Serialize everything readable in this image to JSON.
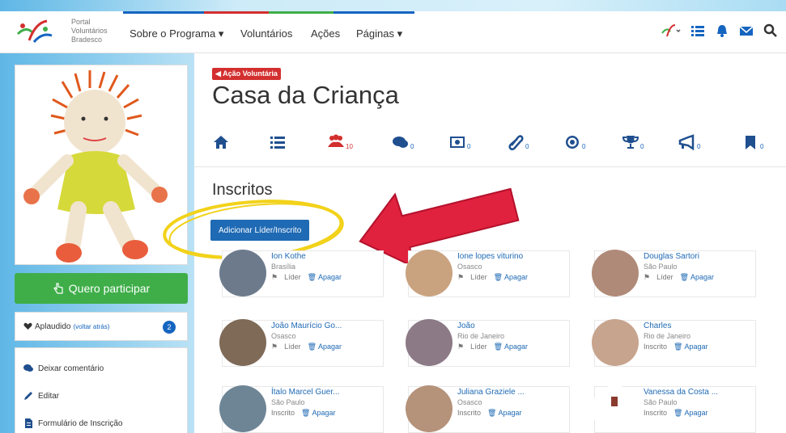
{
  "navbar": {
    "logo_line1": "Portal",
    "logo_line2": "Voluntários",
    "logo_line3": "Bradesco",
    "links": [
      "Sobre o Programa ▾",
      "Voluntários",
      "Ações",
      "Páginas ▾"
    ],
    "icons": [
      "logo-dropdown-icon",
      "list-icon",
      "bell-icon",
      "envelope-icon",
      "search-icon"
    ]
  },
  "left": {
    "participate_label": "Quero participar",
    "applause_label": "Aplaudido",
    "applause_sub": "(voltar atrás)",
    "applause_count": "2",
    "actions": [
      "Deixar comentário",
      "Editar",
      "Formulário de Inscrição"
    ]
  },
  "main": {
    "tag": "Ação Voluntária",
    "title": "Casa da Criança",
    "tabs": [
      {
        "icon": "home-icon",
        "count": ""
      },
      {
        "icon": "list-icon",
        "count": ""
      },
      {
        "icon": "users-icon",
        "count": "10"
      },
      {
        "icon": "comments-icon",
        "count": "0"
      },
      {
        "icon": "photo-icon",
        "count": "0"
      },
      {
        "icon": "paperclip-icon",
        "count": "0"
      },
      {
        "icon": "target-icon",
        "count": "0"
      },
      {
        "icon": "trophy-icon",
        "count": "0"
      },
      {
        "icon": "megaphone-icon",
        "count": "0"
      },
      {
        "icon": "bookmark-icon",
        "count": "0"
      }
    ],
    "section_title": "Inscritos",
    "add_button": "Adicionar Líder/Inscrito",
    "delete_label": "Apagar",
    "members": [
      {
        "name": "Ion Kothe",
        "city": "Brasília",
        "role": "Líder"
      },
      {
        "name": "Ione lopes viturino",
        "city": "Osasco",
        "role": "Líder"
      },
      {
        "name": "Douglas Sartori",
        "city": "São Paulo",
        "role": "Líder"
      },
      {
        "name": "João Maurício Go...",
        "city": "Osasco",
        "role": "Líder"
      },
      {
        "name": "João",
        "city": "Rio de Janeiro",
        "role": "Líder"
      },
      {
        "name": "Charles",
        "city": "Rio de Janeiro",
        "role": "Inscrito"
      },
      {
        "name": "Ítalo Marcel Guer...",
        "city": "São Paulo",
        "role": "Inscrito"
      },
      {
        "name": "Juliana Graziele ...",
        "city": "Osasco",
        "role": "Inscrito"
      },
      {
        "name": "Vanessa da Costa ...",
        "city": "São Paulo",
        "role": "Inscrito"
      }
    ]
  },
  "colors": {
    "primary": "#1f6ab4",
    "success": "#3fae49",
    "danger": "#d32f2f",
    "annotation_arrow": "#e0223f",
    "annotation_circle": "#f2d21a"
  }
}
